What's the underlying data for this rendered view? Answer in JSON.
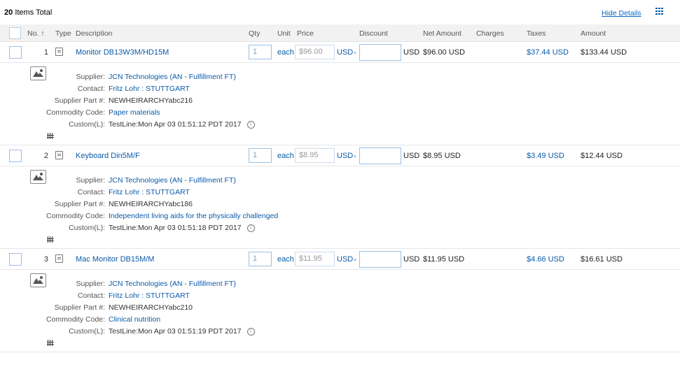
{
  "header": {
    "count": "20",
    "count_label": "Items Total",
    "hide_details": "Hide Details"
  },
  "columns": {
    "no": "No. ↑",
    "type": "Type",
    "description": "Description",
    "qty": "Qty",
    "unit": "Unit",
    "price": "Price",
    "discount": "Discount",
    "net_amount": "Net Amount",
    "charges": "Charges",
    "taxes": "Taxes",
    "amount": "Amount"
  },
  "labels": {
    "supplier": "Supplier:",
    "contact": "Contact:",
    "supplier_part": "Supplier Part #:",
    "commodity": "Commodity Code:",
    "custom": "Custom(L):",
    "info": "i"
  },
  "items": [
    {
      "no": "1",
      "description": "Monitor DB13W3M/HD15M",
      "qty": "1",
      "unit": "each",
      "price": "$96.00",
      "price_currency": "USD",
      "discount": "",
      "discount_currency": "USD",
      "net_amount": "$96.00 USD",
      "taxes": "$37.44 USD",
      "amount": "$133.44 USD",
      "supplier": "JCN Technologies (AN - Fulfillment FT)",
      "contact": "Fritz Lohr : STUTTGART",
      "supplier_part": "NEWHEIRARCHYabc216",
      "commodity": "Paper materials",
      "custom": "TestLine:Mon Apr 03 01:51:12 PDT 2017"
    },
    {
      "no": "2",
      "description": "Keyboard Din5M/F",
      "qty": "1",
      "unit": "each",
      "price": "$8.95",
      "price_currency": "USD",
      "discount": "",
      "discount_currency": "USD",
      "net_amount": "$8.95 USD",
      "taxes": "$3.49 USD",
      "amount": "$12.44 USD",
      "supplier": "JCN Technologies (AN - Fulfillment FT)",
      "contact": "Fritz Lohr : STUTTGART",
      "supplier_part": "NEWHEIRARCHYabc186",
      "commodity": "Independent living aids for the physically challenged",
      "custom": "TestLine:Mon Apr 03 01:51:18 PDT 2017"
    },
    {
      "no": "3",
      "description": "Mac Monitor DB15M/M",
      "qty": "1",
      "unit": "each",
      "price": "$11.95",
      "price_currency": "USD",
      "discount": "",
      "discount_currency": "USD",
      "net_amount": "$11.95 USD",
      "taxes": "$4.66 USD",
      "amount": "$16.61 USD",
      "supplier": "JCN Technologies (AN - Fulfillment FT)",
      "contact": "Fritz Lohr : STUTTGART",
      "supplier_part": "NEWHEIRARCHYabc210",
      "commodity": "Clinical nutrition",
      "custom": "TestLine:Mon Apr 03 01:51:19 PDT 2017"
    }
  ],
  "colors": {
    "link": "#0a5aa8",
    "header_bg": "#f2f2f2",
    "border": "#9cc0e3"
  },
  "icons": {
    "type": "catalog-item-icon",
    "thumb": "image-placeholder-icon",
    "split": "split-accounting-icon",
    "info": "info-icon",
    "grid": "table-options-icon"
  }
}
